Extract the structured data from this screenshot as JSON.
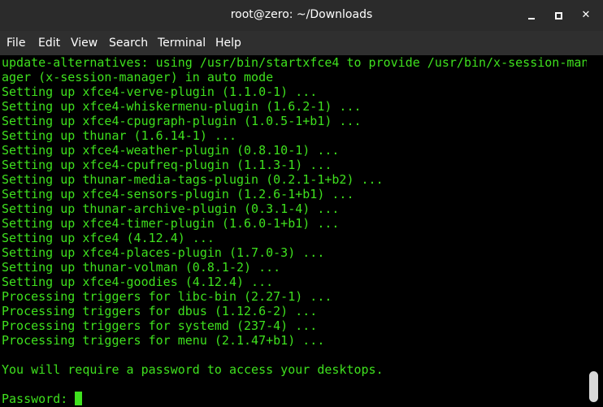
{
  "window": {
    "title": "root@zero: ~/Downloads",
    "minimize_glyph": "",
    "maximize_glyph": "",
    "close_glyph": "✕"
  },
  "menu": {
    "file": "File",
    "edit": "Edit",
    "view": "View",
    "search": "Search",
    "terminal": "Terminal",
    "help": "Help"
  },
  "terminal": {
    "lines": [
      "update-alternatives: using /usr/bin/startxfce4 to provide /usr/bin/x-session-man",
      "ager (x-session-manager) in auto mode",
      "Setting up xfce4-verve-plugin (1.1.0-1) ...",
      "Setting up xfce4-whiskermenu-plugin (1.6.2-1) ...",
      "Setting up xfce4-cpugraph-plugin (1.0.5-1+b1) ...",
      "Setting up thunar (1.6.14-1) ...",
      "Setting up xfce4-weather-plugin (0.8.10-1) ...",
      "Setting up xfce4-cpufreq-plugin (1.1.3-1) ...",
      "Setting up thunar-media-tags-plugin (0.2.1-1+b2) ...",
      "Setting up xfce4-sensors-plugin (1.2.6-1+b1) ...",
      "Setting up thunar-archive-plugin (0.3.1-4) ...",
      "Setting up xfce4-timer-plugin (1.6.0-1+b1) ...",
      "Setting up xfce4 (4.12.4) ...",
      "Setting up xfce4-places-plugin (1.7.0-3) ...",
      "Setting up thunar-volman (0.8.1-2) ...",
      "Setting up xfce4-goodies (4.12.4) ...",
      "Processing triggers for libc-bin (2.27-1) ...",
      "Processing triggers for dbus (1.12.6-2) ...",
      "Processing triggers for systemd (237-4) ...",
      "Processing triggers for menu (2.1.47+b1) ...",
      "",
      "You will require a password to access your desktops.",
      ""
    ],
    "prompt": "Password: "
  },
  "colors": {
    "terminal_text": "#3fe11e",
    "terminal_bg": "#000000",
    "titlebar_bg": "#2b2b2b",
    "menubar_bg": "#2f2f2f"
  }
}
